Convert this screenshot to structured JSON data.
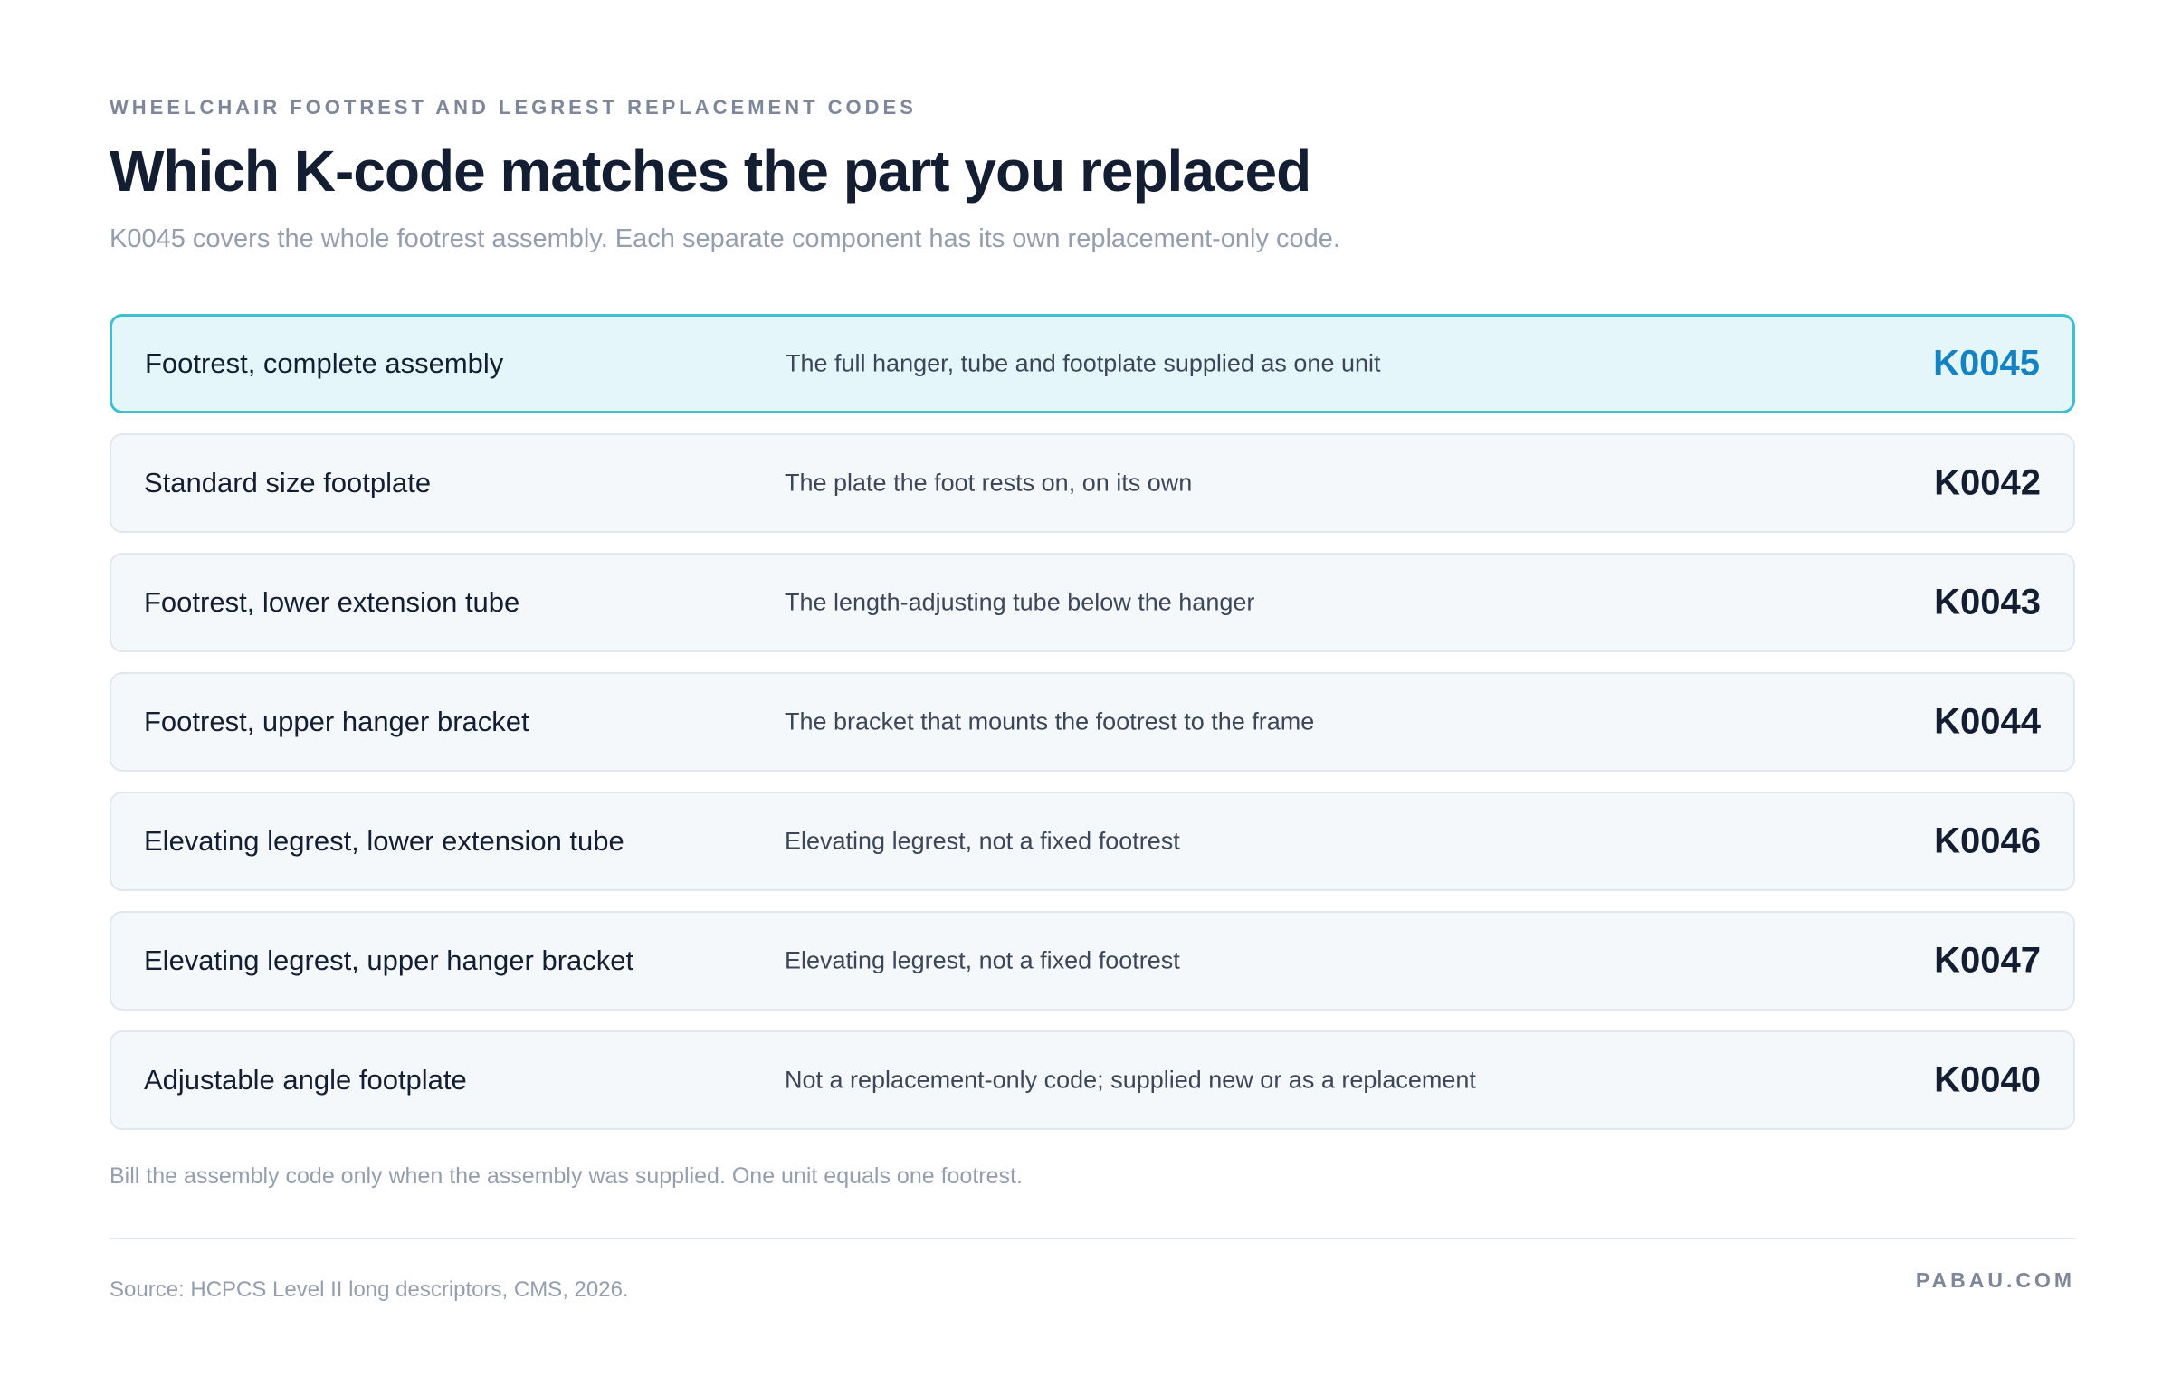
{
  "header": {
    "eyebrow": "WHEELCHAIR FOOTREST AND LEGREST REPLACEMENT CODES",
    "title": "Which K-code matches the part you replaced",
    "subtitle": "K0045 covers the whole footrest assembly. Each separate component has its own replacement-only code."
  },
  "rows": [
    {
      "part": "Footrest, complete assembly",
      "description": "The full hanger, tube and footplate supplied as one unit",
      "code": "K0045",
      "highlighted": true
    },
    {
      "part": "Standard size footplate",
      "description": "The plate the foot rests on, on its own",
      "code": "K0042",
      "highlighted": false
    },
    {
      "part": "Footrest, lower extension tube",
      "description": "The length-adjusting tube below the hanger",
      "code": "K0043",
      "highlighted": false
    },
    {
      "part": "Footrest, upper hanger bracket",
      "description": "The bracket that mounts the footrest to the frame",
      "code": "K0044",
      "highlighted": false
    },
    {
      "part": "Elevating legrest, lower extension tube",
      "description": "Elevating legrest, not a fixed footrest",
      "code": "K0046",
      "highlighted": false
    },
    {
      "part": "Elevating legrest, upper hanger bracket",
      "description": "Elevating legrest, not a fixed footrest",
      "code": "K0047",
      "highlighted": false
    },
    {
      "part": "Adjustable angle footplate",
      "description": "Not a replacement-only code; supplied new or as a replacement",
      "code": "K0040",
      "highlighted": false
    }
  ],
  "footnote": "Bill the assembly code only when the assembly was supplied. One unit equals one footrest.",
  "footer": {
    "source": "Source: HCPCS Level II long descriptors, CMS, 2026.",
    "brand": "PABAU.COM"
  },
  "colors": {
    "highlight_background": "#e4f6f9",
    "highlight_border": "#3fc0d2",
    "highlight_code": "#1582c4",
    "row_background": "#f4f8fb",
    "text_dark": "#141e33",
    "text_muted": "#959eae"
  }
}
